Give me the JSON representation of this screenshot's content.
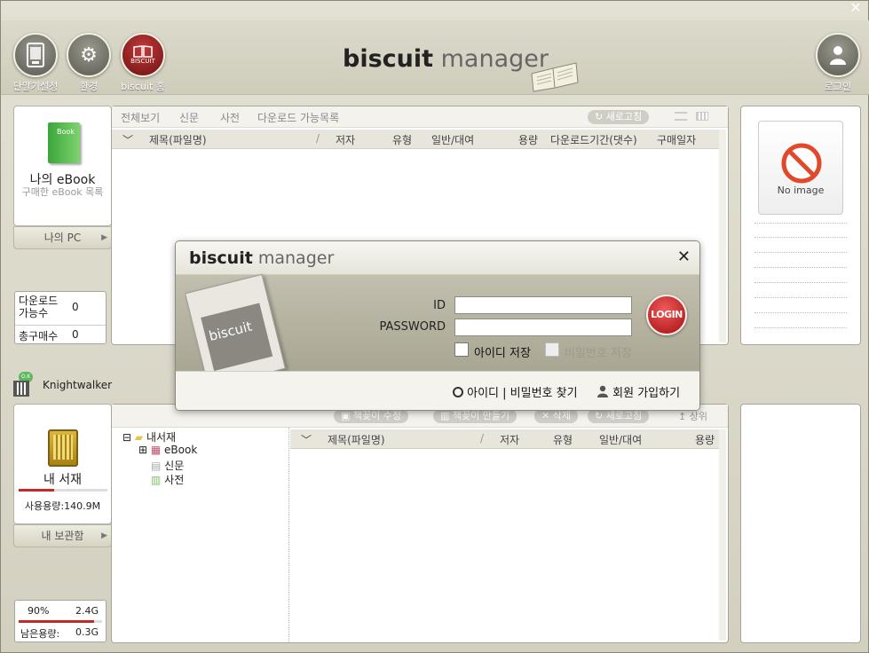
{
  "window": {
    "close": "✕"
  },
  "toolbar": {
    "device_settings": "단말기설정",
    "settings": "환경",
    "biscuit_home": "biscuit 홈",
    "biscuit_badge": "BISCUIT",
    "login": "로그인"
  },
  "brand": {
    "bold": "biscuit",
    "light": " manager"
  },
  "store_panel": {
    "tabs": [
      "전체보기",
      "신문",
      "사전",
      "다운로드 가능목록"
    ],
    "refresh": "새로고침",
    "columns": [
      "제목(파일명)",
      "저자",
      "유형",
      "일반/대여",
      "용량",
      "다운로드기간(댓수)",
      "구매일자"
    ]
  },
  "my_ebook": {
    "book_label": "Book",
    "title": "나의 eBook",
    "subtitle": "구매한 eBook 목록",
    "tab": "나의 PC"
  },
  "download_info": {
    "available_label_1": "다운로드",
    "available_label_2": "가능수",
    "available_value": "0",
    "total_label": "총구매수",
    "total_value": "0"
  },
  "preview": {
    "no_image": "No image"
  },
  "device": {
    "ok_badge": "O.K",
    "name": "Knightwalker"
  },
  "library_panel": {
    "actions": [
      "책꽂이 수정",
      "책꽂이 만들기",
      "삭제",
      "새로고침",
      "상위"
    ],
    "tree": {
      "root": "내서재",
      "children": [
        "eBook",
        "신문",
        "사전"
      ]
    },
    "columns": [
      "제목(파일명)",
      "저자",
      "유형",
      "일반/대여",
      "용량"
    ]
  },
  "my_library": {
    "title": "내 서재",
    "usage": "사용용량:140.9M",
    "usage_fraction": 0.4,
    "tab": "내 보관함"
  },
  "storage": {
    "percent": "90%",
    "total": "2.4G",
    "remaining_label": "남은용량:",
    "remaining": "0.3G",
    "fill_fraction": 0.9
  },
  "login_dialog": {
    "brand_bold": "biscuit",
    "brand_light": " manager",
    "close": "✕",
    "device_text": "biscuit",
    "id_label": "ID",
    "id_value": "",
    "password_label": "PASSWORD",
    "password_value": "",
    "login_button": "LOGIN",
    "save_id": "아이디 저장",
    "save_password": "비밀번호 저장",
    "find_account": "아이디 | 비밀번호 찾기",
    "signup": "회원 가입하기"
  },
  "colors": {
    "accent_red": "#c62828",
    "frame": "#d8d5c6"
  }
}
